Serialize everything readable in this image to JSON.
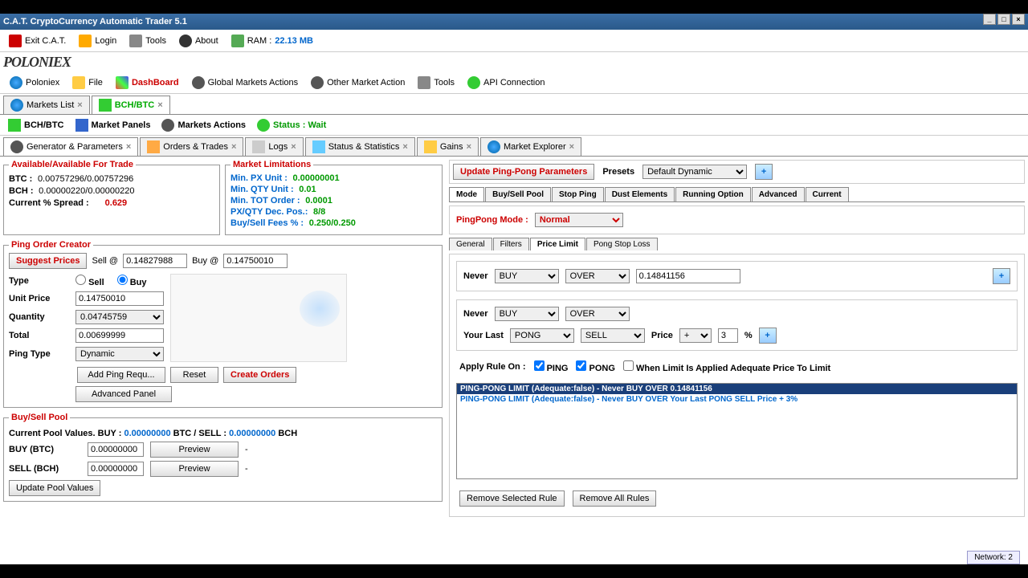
{
  "window": {
    "title": "C.A.T. CryptoCurrency Automatic Trader 5.1"
  },
  "menu": {
    "exit": "Exit C.A.T.",
    "login": "Login",
    "tools": "Tools",
    "about": "About",
    "ram_label": "RAM :",
    "ram_value": "22.13 MB"
  },
  "logo": "POLONIEX",
  "toolbar2": {
    "poloniex": "Poloniex",
    "file": "File",
    "dashboard": "DashBoard",
    "gma": "Global Markets Actions",
    "oma": "Other Market Action",
    "tools": "Tools",
    "api": "API Connection"
  },
  "main_tabs": {
    "markets_list": "Markets List",
    "bchbtc": "BCH/BTC"
  },
  "subtoolbar": {
    "pair": "BCH/BTC",
    "panels": "Market Panels",
    "actions": "Markets Actions",
    "status_label": "Status :",
    "status_value": "Wait"
  },
  "subtabs": {
    "gen": "Generator & Parameters",
    "orders": "Orders & Trades",
    "logs": "Logs",
    "stats": "Status & Statistics",
    "gains": "Gains",
    "explorer": "Market Explorer"
  },
  "avail": {
    "legend": "Available/Available For Trade",
    "btc_label": "BTC  :",
    "btc_value": "0.00757296/0.00757296",
    "bch_label": "BCH  :",
    "bch_value": "0.00000220/0.00000220",
    "spread_label": "Current % Spread :",
    "spread_value": "0.629"
  },
  "mktlim": {
    "legend": "Market Limitations",
    "rows": [
      {
        "k": "Min. PX  Unit  :",
        "v": "0.00000001"
      },
      {
        "k": "Min. QTY Unit  :",
        "v": "0.01"
      },
      {
        "k": "Min. TOT Order :",
        "v": "0.0001"
      },
      {
        "k": "PX/QTY Dec. Pos.:",
        "v": "8/8"
      },
      {
        "k": "Buy/Sell Fees % :",
        "v": "0.250/0.250"
      }
    ]
  },
  "poc": {
    "legend": "Ping Order Creator",
    "suggest": "Suggest Prices",
    "sell_at": "Sell @",
    "sell_val": "0.14827988",
    "buy_at": "Buy @",
    "buy_val": "0.14750010",
    "type": "Type",
    "sell": "Sell",
    "buy": "Buy",
    "unit_price": "Unit Price",
    "unit_price_val": "0.14750010",
    "quantity": "Quantity",
    "quantity_val": "0.04745759",
    "total": "Total",
    "total_val": "0.00699999",
    "ping_type": "Ping Type",
    "ping_type_val": "Dynamic",
    "add_req": "Add Ping Requ...",
    "reset": "Reset",
    "create": "Create Orders",
    "advanced": "Advanced Panel"
  },
  "bsp": {
    "legend": "Buy/Sell Pool",
    "pool_text_1": "Current Pool Values. BUY :",
    "pool_btc": "0.00000000",
    "pool_text_2": "BTC / SELL :",
    "pool_bch": "0.00000000",
    "pool_text_3": "BCH",
    "buy_label": "BUY (BTC)",
    "buy_val": "0.00000000",
    "sell_label": "SELL (BCH)",
    "sell_val": "0.00000000",
    "preview": "Preview",
    "dash": "-",
    "update": "Update Pool Values"
  },
  "right": {
    "update_btn": "Update Ping-Pong Parameters",
    "presets": "Presets",
    "preset_val": "Default Dynamic",
    "tabs": [
      "Mode",
      "Buy/Sell Pool",
      "Stop Ping",
      "Dust Elements",
      "Running Option",
      "Advanced",
      "Current"
    ],
    "mode_label": "PingPong Mode :",
    "mode_val": "Normal",
    "subtabs": [
      "General",
      "Filters",
      "Price Limit",
      "Pong Stop Loss"
    ],
    "rule1": {
      "never": "Never",
      "buy": "BUY",
      "over": "OVER",
      "val": "0.14841156"
    },
    "rule2": {
      "never": "Never",
      "buy": "BUY",
      "over": "OVER",
      "your_last": "Your Last",
      "pong": "PONG",
      "sell": "SELL",
      "price": "Price",
      "plus": "+",
      "pct_val": "3",
      "pct": "%"
    },
    "apply": {
      "label": "Apply Rule On :",
      "ping": "PING",
      "pong": "PONG",
      "limit": "When Limit Is Applied Adequate Price To Limit"
    },
    "rules": [
      "PING-PONG LIMIT (Adequate:false) - Never BUY OVER 0.14841156",
      "PING-PONG LIMIT (Adequate:false) - Never BUY OVER Your Last PONG SELL Price + 3%"
    ],
    "remove_sel": "Remove Selected Rule",
    "remove_all": "Remove All Rules"
  },
  "statusbar": "Network: 2"
}
